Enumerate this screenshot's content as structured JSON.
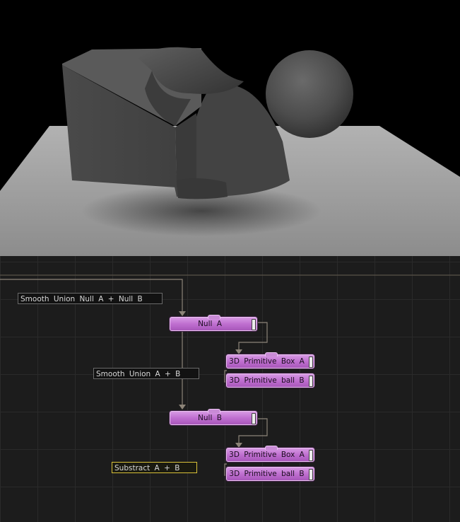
{
  "viewport": {
    "scene": "3d-render-preview",
    "colors": {
      "background": "#000000",
      "floor": "#9a9a9a",
      "shape": "#4a4a4a"
    }
  },
  "graph": {
    "colors": {
      "background": "#1c1c1c",
      "grid": "#2a2a2a",
      "wire": "#8c8478",
      "node": "#c27ad3",
      "comment_selected": "#d9c23a"
    },
    "comments": [
      {
        "text": "Smooth  Union  Null  A  +  Null  B",
        "selected": false
      },
      {
        "text": "Smooth  Union  A  +  B",
        "selected": false
      },
      {
        "text": "Substract  A  +  B",
        "selected": true
      }
    ],
    "nodes": {
      "null_a": "Null  A",
      "box_a_1": "3D  Primitive  Box  A",
      "ball_b_1": "3D  Primitive  ball  B",
      "null_b": "Null  B",
      "box_a_2": "3D  Primitive  Box  A",
      "ball_b_2": "3D  Primitive  ball  B"
    }
  }
}
